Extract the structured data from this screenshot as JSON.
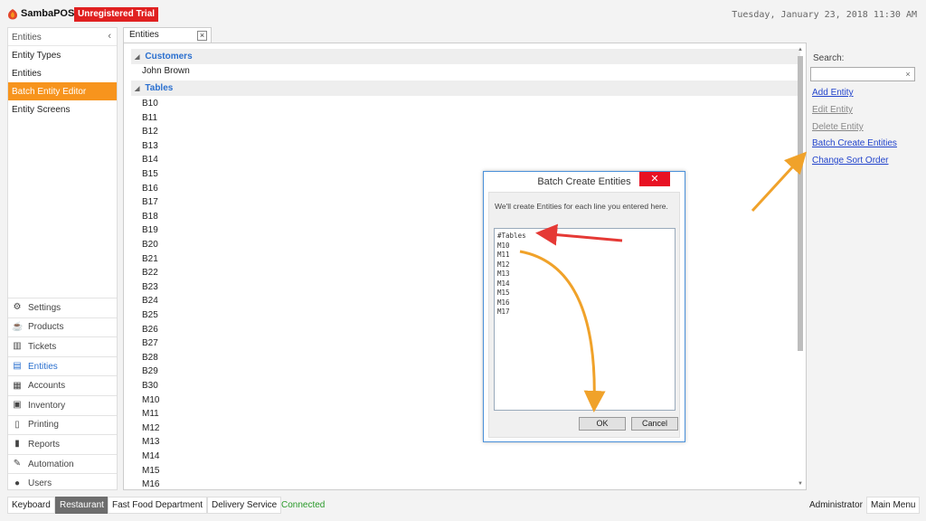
{
  "titlebar": {
    "app_name": "SambaPOS",
    "trial_badge": "Unregistered Trial",
    "datetime": "Tuesday, January 23, 2018 11:30 AM",
    "logo_icon": "samba-logo-icon"
  },
  "left_panel": {
    "header": "Entities",
    "collapse_icon": "‹",
    "items": [
      {
        "label": "Entity Types"
      },
      {
        "label": "Entities"
      },
      {
        "label": "Batch Entity Editor"
      },
      {
        "label": "Entity Screens"
      }
    ],
    "active_index": 2,
    "nav": [
      {
        "label": "Settings",
        "icon": "gear-icon",
        "glyph": "⚙"
      },
      {
        "label": "Products",
        "icon": "coffee-icon",
        "glyph": "☕"
      },
      {
        "label": "Tickets",
        "icon": "books-icon",
        "glyph": "▥"
      },
      {
        "label": "Entities",
        "icon": "table-icon",
        "glyph": "▤"
      },
      {
        "label": "Accounts",
        "icon": "calculator-icon",
        "glyph": "▦"
      },
      {
        "label": "Inventory",
        "icon": "cubes-icon",
        "glyph": "▣"
      },
      {
        "label": "Printing",
        "icon": "document-icon",
        "glyph": "▯"
      },
      {
        "label": "Reports",
        "icon": "bar-chart-icon",
        "glyph": "▮"
      },
      {
        "label": "Automation",
        "icon": "pen-icon",
        "glyph": "✎"
      },
      {
        "label": "Users",
        "icon": "user-icon",
        "glyph": "●"
      }
    ],
    "nav_active_index": 3
  },
  "tab": {
    "label": "Entities",
    "close": "×"
  },
  "list": {
    "groups": [
      {
        "name": "Customers",
        "items": [
          "John Brown"
        ]
      },
      {
        "name": "Tables",
        "items": [
          "B10",
          "B11",
          "B12",
          "B13",
          "B14",
          "B15",
          "B16",
          "B17",
          "B18",
          "B19",
          "B20",
          "B21",
          "B22",
          "B23",
          "B24",
          "B25",
          "B26",
          "B27",
          "B28",
          "B29",
          "B30",
          "M10",
          "M11",
          "M12",
          "M13",
          "M14",
          "M15",
          "M16"
        ]
      }
    ]
  },
  "right_panel": {
    "search_label": "Search:",
    "search_value": "",
    "search_clear": "×",
    "actions": [
      {
        "label": "Add Entity",
        "enabled": true
      },
      {
        "label": "Edit Entity",
        "enabled": false
      },
      {
        "label": "Delete Entity",
        "enabled": false
      },
      {
        "label": "Batch Create Entities",
        "enabled": true
      },
      {
        "label": "Change Sort Order",
        "enabled": true
      }
    ]
  },
  "dialog": {
    "title": "Batch Create Entities",
    "close": "✕",
    "message": "We'll create Entities for each line you entered here.",
    "text": "#Tables\nM10\nM11\nM12\nM13\nM14\nM15\nM16\nM17",
    "ok": "OK",
    "cancel": "Cancel"
  },
  "bottombar": {
    "buttons": [
      {
        "label": "Keyboard",
        "active": false
      },
      {
        "label": "Restaurant",
        "active": true
      },
      {
        "label": "Fast Food Department",
        "active": false
      },
      {
        "label": "Delivery Service",
        "active": false
      }
    ],
    "status": "Connected",
    "user": "Administrator",
    "main_menu": "Main Menu"
  },
  "colors": {
    "accent": "#f7941d",
    "trial": "#e02020",
    "link": "#2244cc",
    "group_header": "#2a6fcf",
    "status_ok": "#2a9a2a",
    "annotation_orange": "#f0a22a",
    "annotation_red": "#e53935"
  }
}
